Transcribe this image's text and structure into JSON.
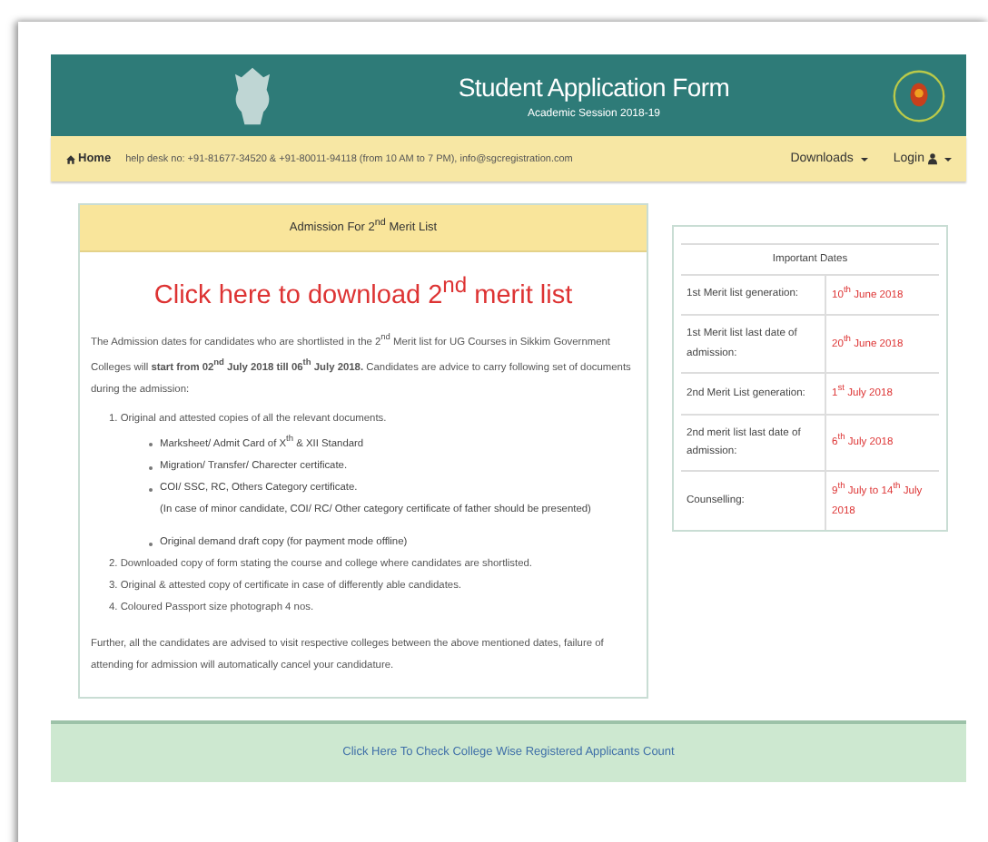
{
  "header": {
    "title": "Student Application Form",
    "subtitle": "Academic Session 2018-19"
  },
  "nav": {
    "home": "Home",
    "helpdesk": "help desk no: +91-81677-34520 & +91-80011-94118 (from 10 AM to 7 PM), info@sgcregistration.com",
    "menus": [
      {
        "label": "Downloads",
        "kind": "dropdown"
      },
      {
        "label": "Login",
        "kind": "user"
      }
    ]
  },
  "admission": {
    "heading": "Admission For 2$^{nd}$ Merit List",
    "download_link": "Click here to download 2$^{nd}$ merit list",
    "intro": "The Admission dates for candidates who are shortlisted in the 2$^{nd}$ Merit list for UG Courses in Sikkim Government Colleges will **start from 02$^{nd}$ July 2018 till 06$^{th}$ July 2018.** Candidates are advice to carry following set of documents during the admission:",
    "documents": [
      {
        "number": "1.",
        "text": "Original and attested copies of all the relevant documents.",
        "children": [
          {
            "text": "Marksheet/ Admit Card of X$^{th}$ & XII Standard"
          },
          {
            "text": "Migration/ Transfer/ Charecter certificate."
          },
          {
            "text": "COI/ SSC, RC, Others Category certificate.",
            "note": "(In case of minor candidate, COI/ RC/ Other category certificate of father should be presented)"
          },
          {
            "text": "Original demand draft copy (for payment mode offline)"
          }
        ]
      },
      {
        "number": "2.",
        "text": "Downloaded copy of form stating the course and college where candidates are shortlisted."
      },
      {
        "number": "3.",
        "text": "Original & attested copy of certificate in case of differently able candidates."
      },
      {
        "number": "4.",
        "text": "Coloured Passport size photograph 4 nos."
      }
    ],
    "footer_note": "Further, all the candidates are advised to visit respective colleges between the above mentioned dates, failure of attending for admission will automatically cancel your candidature."
  },
  "important_dates": {
    "title": "Important Dates",
    "rows": [
      {
        "event": "1st Merit list generation:",
        "date": "10$^{th}$ June 2018"
      },
      {
        "event": "1st Merit list last date of admission:",
        "date": "20$^{th}$ June 2018"
      },
      {
        "event": "2nd Merit List generation:",
        "date": "1$^{st}$ July 2018"
      },
      {
        "event": "2nd merit list last date of admission:",
        "date": "6$^{th}$ July 2018"
      },
      {
        "event": "Counselling:",
        "date": "9$^{th}$ July to 14$^{th}$ July 2018"
      }
    ]
  },
  "applicants_link": "Click Here To Check College Wise Registered Applicants Count"
}
